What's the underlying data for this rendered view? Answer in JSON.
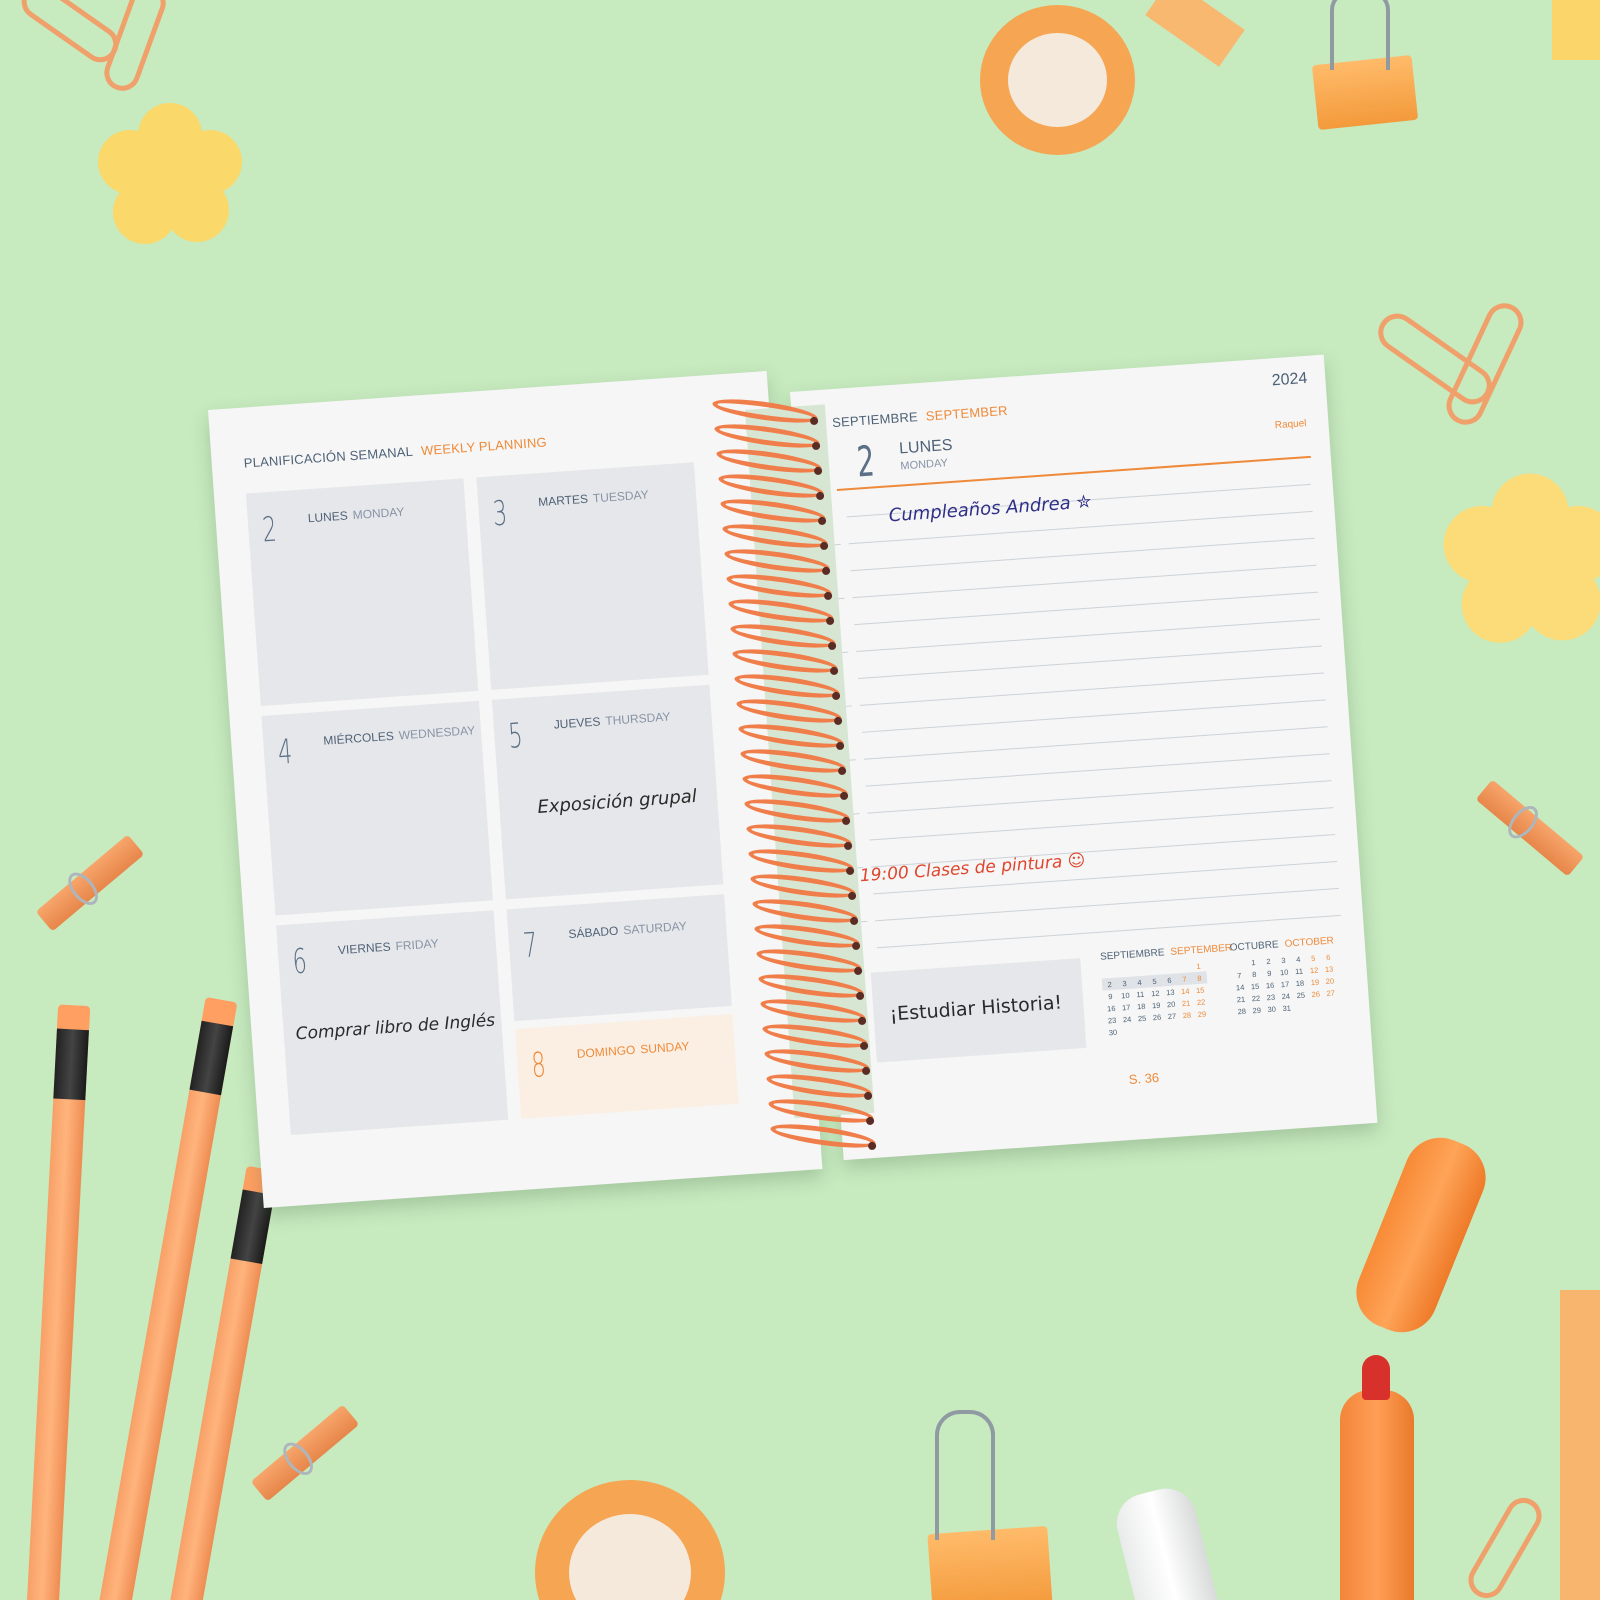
{
  "planner": {
    "left_page": {
      "header_es": "PLANIFICACIÓN SEMANAL",
      "header_en": "WEEKLY PLANNING",
      "days": [
        {
          "num": "2",
          "es": "LUNES",
          "en": "MONDAY",
          "note": ""
        },
        {
          "num": "3",
          "es": "MARTES",
          "en": "TUESDAY",
          "note": ""
        },
        {
          "num": "4",
          "es": "MIÉRCOLES",
          "en": "WEDNESDAY",
          "note": ""
        },
        {
          "num": "5",
          "es": "JUEVES",
          "en": "THURSDAY",
          "note": "Exposición grupal"
        },
        {
          "num": "6",
          "es": "VIERNES",
          "en": "FRIDAY",
          "note": "Comprar libro de Inglés"
        },
        {
          "num": "7",
          "es": "SÁBADO",
          "en": "SATURDAY",
          "note": ""
        },
        {
          "num": "8",
          "es": "DOMINGO",
          "en": "SUNDAY",
          "note": ""
        }
      ]
    },
    "right_page": {
      "year": "2024",
      "month_es": "SEPTIEMBRE",
      "month_en": "SEPTEMBER",
      "day_num": "2",
      "day_es": "LUNES",
      "day_en": "MONDAY",
      "saint": "Raquel",
      "note_1": "Cumpleaños Andrea ✮",
      "note_2": "19:00  Clases de pintura ☺",
      "sticky_note": "¡Estudiar Historia!",
      "week_label": "S. 36",
      "mini_cal_sep": {
        "title_es": "SEPTIEMBRE",
        "title_en": "SEPTEMBER",
        "rows": [
          [
            "",
            "",
            "",
            "",
            "",
            "",
            "1"
          ],
          [
            "2",
            "3",
            "4",
            "5",
            "6",
            "7",
            "8"
          ],
          [
            "9",
            "10",
            "11",
            "12",
            "13",
            "14",
            "15"
          ],
          [
            "16",
            "17",
            "18",
            "19",
            "20",
            "21",
            "22"
          ],
          [
            "23",
            "24",
            "25",
            "26",
            "27",
            "28",
            "29"
          ],
          [
            "30",
            "",
            "",
            "",
            "",
            "",
            ""
          ]
        ]
      },
      "mini_cal_oct": {
        "title_es": "OCTUBRE",
        "title_en": "OCTOBER",
        "rows": [
          [
            "",
            "1",
            "2",
            "3",
            "4",
            "5",
            "6"
          ],
          [
            "7",
            "8",
            "9",
            "10",
            "11",
            "12",
            "13"
          ],
          [
            "14",
            "15",
            "16",
            "17",
            "18",
            "19",
            "20"
          ],
          [
            "21",
            "22",
            "23",
            "24",
            "25",
            "26",
            "27"
          ],
          [
            "28",
            "29",
            "30",
            "31",
            "",
            "",
            ""
          ]
        ]
      }
    }
  },
  "colors": {
    "background": "#c7eabf",
    "accent_orange": "#ef8a3a",
    "label_slate": "#4f6277",
    "box_gray": "#e6e7ea",
    "spiral": "#f07e4a",
    "ink_blue": "#2f2f8a",
    "ink_red": "#e0452e",
    "ink_black": "#2a2a2a"
  }
}
